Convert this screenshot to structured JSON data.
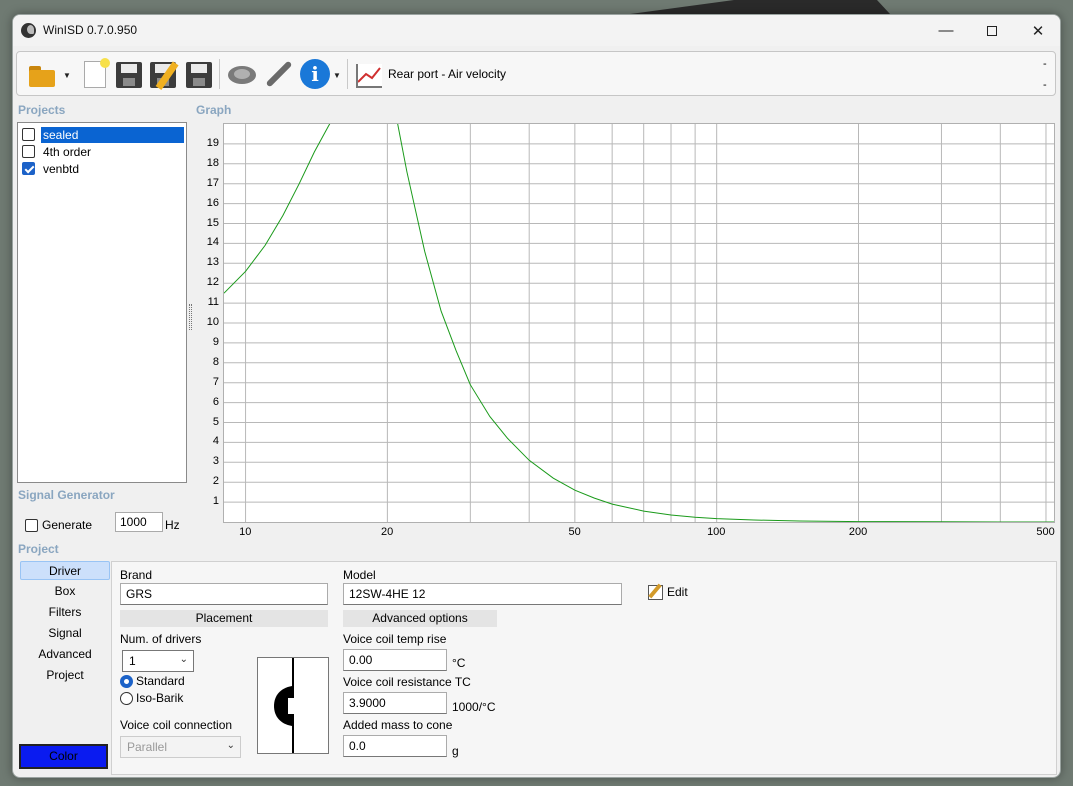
{
  "window": {
    "title": "WinISD 0.7.0.950"
  },
  "toolbar": {
    "graph_label": "Rear port - Air velocity",
    "dash_top": "-",
    "dash_bottom": "-"
  },
  "sections": {
    "projects": "Projects",
    "graph": "Graph",
    "signal_generator": "Signal Generator",
    "project": "Project"
  },
  "projects": [
    {
      "name": "sealed",
      "checked": false,
      "selected": true
    },
    {
      "name": "4th order",
      "checked": false,
      "selected": false
    },
    {
      "name": "venbtd",
      "checked": true,
      "selected": false
    }
  ],
  "chart_data": {
    "type": "line",
    "title": "",
    "xlabel": "",
    "ylabel": "",
    "x_scale": "log",
    "xlim": [
      9,
      520
    ],
    "ylim": [
      0,
      20
    ],
    "x_tick_labels": [
      "10",
      "20",
      "50",
      "100",
      "200",
      "500"
    ],
    "y_tick_labels": [
      "1",
      "2",
      "3",
      "4",
      "5",
      "6",
      "7",
      "8",
      "9",
      "10",
      "11",
      "12",
      "13",
      "14",
      "15",
      "16",
      "17",
      "18",
      "19"
    ],
    "grid": true,
    "series": [
      {
        "color": "#1a9a1a",
        "x": [
          9,
          10,
          11,
          12,
          13,
          14,
          15,
          15.6,
          20.8,
          22,
          24,
          26,
          28,
          30,
          33,
          36,
          40,
          45,
          50,
          55,
          60,
          70,
          80,
          90,
          100,
          120,
          150,
          200,
          300,
          400,
          520
        ],
        "y": [
          11.5,
          12.6,
          13.9,
          15.4,
          17.0,
          18.6,
          19.9,
          20.6,
          20.6,
          17.6,
          13.6,
          10.6,
          8.6,
          6.9,
          5.3,
          4.2,
          3.1,
          2.2,
          1.6,
          1.2,
          0.9,
          0.55,
          0.35,
          0.24,
          0.17,
          0.1,
          0.05,
          0.02,
          0.01,
          0.0,
          0.0
        ]
      }
    ]
  },
  "signal_generator": {
    "generate_label": "Generate",
    "generate_checked": false,
    "frequency": "1000",
    "unit": "Hz"
  },
  "nav": {
    "items": [
      "Driver",
      "Box",
      "Filters",
      "Signal",
      "Advanced",
      "Project"
    ],
    "active": "Driver",
    "color_label": "Color",
    "color_value": "#0a1bf0"
  },
  "driver": {
    "brand_label": "Brand",
    "brand": "GRS",
    "model_label": "Model",
    "model": "12SW-4HE 12",
    "edit_label": "Edit",
    "placement_head": "Placement",
    "num_drivers_label": "Num. of drivers",
    "num_drivers": "1",
    "radio_standard": "Standard",
    "radio_isobarik": "Iso-Barik",
    "vc_connection_label": "Voice coil connection",
    "vc_connection": "Parallel",
    "advanced_head": "Advanced options",
    "vc_temp_rise_label": "Voice coil temp rise",
    "vc_temp_rise": "0.00",
    "vc_temp_rise_unit": "°C",
    "vc_resistance_tc_label": "Voice coil resistance TC",
    "vc_resistance_tc": "3.9000",
    "vc_resistance_tc_unit": "1000/°C",
    "added_mass_label": "Added mass to cone",
    "added_mass": "0.0",
    "added_mass_unit": "g"
  }
}
